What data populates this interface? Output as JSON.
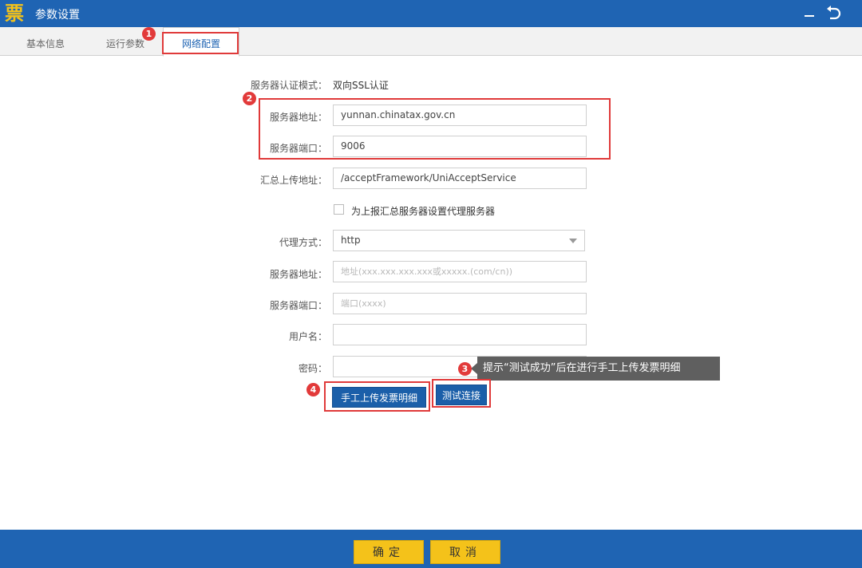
{
  "window": {
    "logo_char": "票",
    "title": "参数设置"
  },
  "tabs": [
    {
      "label": "基本信息"
    },
    {
      "label": "运行参数"
    },
    {
      "label": "网络配置"
    }
  ],
  "form": {
    "auth_mode_label": "服务器认证模式：",
    "auth_mode_value": "双向SSL认证",
    "server_addr_label": "服务器地址：",
    "server_addr_value": "yunnan.chinatax.gov.cn",
    "server_port_label": "服务器端口：",
    "server_port_value": "9006",
    "upload_addr_label": "汇总上传地址：",
    "upload_addr_value": "/acceptFramework/UniAcceptService",
    "proxy_checkbox_label": "为上报汇总服务器设置代理服务器",
    "proxy_checkbox_checked": false,
    "proxy_method_label": "代理方式：",
    "proxy_method_value": "http",
    "proxy_addr_label": "服务器地址：",
    "proxy_addr_placeholder": "地址(xxx.xxx.xxx.xxx或xxxxx.(com/cn))",
    "proxy_port_label": "服务器端口：",
    "proxy_port_placeholder": "端口(xxxx)",
    "username_label": "用户名：",
    "username_value": "",
    "password_label": "密码：",
    "password_value": ""
  },
  "actions": {
    "manual_upload_label": "手工上传发票明细",
    "test_connection_label": "测试连接"
  },
  "annotations": {
    "badge_1": "1",
    "badge_2": "2",
    "badge_3": "3",
    "badge_4": "4",
    "tooltip": "提示“测试成功”后在进行手工上传发票明细",
    "highlight_color": "#e03a3a"
  },
  "footer": {
    "confirm_label": "确定",
    "cancel_label": "取消"
  },
  "colors": {
    "brand_blue": "#1f64b3",
    "button_blue": "#1b5fa9",
    "button_yellow": "#f4c21a"
  }
}
